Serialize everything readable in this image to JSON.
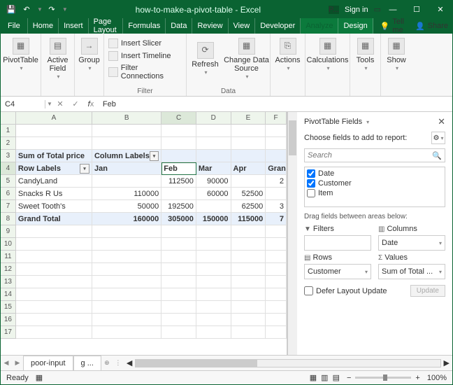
{
  "title": "how-to-make-a-pivot-table - Excel",
  "signin": "Sign in",
  "qat": {
    "save": "💾",
    "undo": "↶",
    "redo": "↷"
  },
  "tabs": [
    "File",
    "Home",
    "Insert",
    "Page Layout",
    "Formulas",
    "Data",
    "Review",
    "View",
    "Developer",
    "Analyze",
    "Design"
  ],
  "tellme": "Tell me",
  "share": "Share",
  "ribbon": {
    "pivottable": "PivotTable",
    "activefield": "Active\nField",
    "group": "Group",
    "insertSlicer": "Insert Slicer",
    "insertTimeline": "Insert Timeline",
    "filterConnections": "Filter Connections",
    "filterLabel": "Filter",
    "refresh": "Refresh",
    "changeData": "Change Data\nSource",
    "dataLabel": "Data",
    "actions": "Actions",
    "calculations": "Calculations",
    "tools": "Tools",
    "show": "Show"
  },
  "namebox": {
    "cell": "C4",
    "formula": "Feb"
  },
  "cols": {
    "A": 110,
    "B": 100,
    "C": 50,
    "D": 50,
    "E": 50,
    "F": 30
  },
  "grid": {
    "r3": {
      "A": "Sum of Total price",
      "B": "Column Labels"
    },
    "r4": {
      "A": "Row Labels",
      "B": "Jan",
      "C": "Feb",
      "D": "Mar",
      "E": "Apr",
      "F": "Grand"
    },
    "r5": {
      "A": "CandyLand",
      "C": "112500",
      "D": "90000",
      "F": "2"
    },
    "r6": {
      "A": "Snacks R Us",
      "B": "110000",
      "D": "60000",
      "E": "52500",
      "F": ""
    },
    "r7": {
      "A": "Sweet Tooth's",
      "B": "50000",
      "C": "192500",
      "E": "62500",
      "F": "3"
    },
    "r8": {
      "A": "Grand Total",
      "B": "160000",
      "C": "305000",
      "D": "150000",
      "E": "115000",
      "F": "7"
    }
  },
  "rowcount": 17,
  "sheettabs": [
    "poor-input",
    "g ..."
  ],
  "pane": {
    "title": "PivotTable Fields",
    "sub": "Choose fields to add to report:",
    "searchPlaceholder": "Search",
    "fields": [
      {
        "label": "Date",
        "checked": true
      },
      {
        "label": "Customer",
        "checked": true
      },
      {
        "label": "Item",
        "checked": false
      }
    ],
    "dragLabel": "Drag fields between areas below:",
    "areas": {
      "filters": {
        "label": "Filters",
        "value": ""
      },
      "columns": {
        "label": "Columns",
        "value": "Date"
      },
      "rows": {
        "label": "Rows",
        "value": "Customer"
      },
      "values": {
        "label": "Values",
        "value": "Sum of Total ..."
      }
    },
    "defer": "Defer Layout Update",
    "update": "Update"
  },
  "status": {
    "ready": "Ready",
    "zoom": "100%"
  }
}
